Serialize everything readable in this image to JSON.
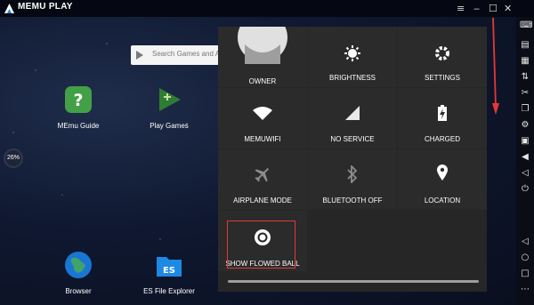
{
  "titlebar": {
    "title": "MEMU PLAY",
    "menu_icon": "≡",
    "minimize_icon": "‒",
    "maximize_icon": "☐",
    "close_icon": "✕"
  },
  "search": {
    "placeholder": "Search Games and Ap"
  },
  "desktop_apps": [
    {
      "label": "MEmu Guide"
    },
    {
      "label": "Play Games"
    },
    {
      "label": "Browser"
    },
    {
      "label": "ES File Explorer"
    }
  ],
  "gauge": {
    "value": "26%"
  },
  "quick_settings": {
    "owner": "OWNER",
    "brightness": "BRIGHTNESS",
    "settings": "SETTINGS",
    "wifi": "MEMUWIFI",
    "service": "NO SERVICE",
    "battery": "CHARGED",
    "airplane": "AIRPLANE MODE",
    "bluetooth": "BLUETOOTH OFF",
    "location": "LOCATION",
    "show_flowed_ball": "SHOW FLOWED BALL"
  },
  "colors": {
    "accent_red": "#e53935",
    "panel": "#262626",
    "tile": "#2b2b2b",
    "disabled": "#8c8c8c"
  }
}
